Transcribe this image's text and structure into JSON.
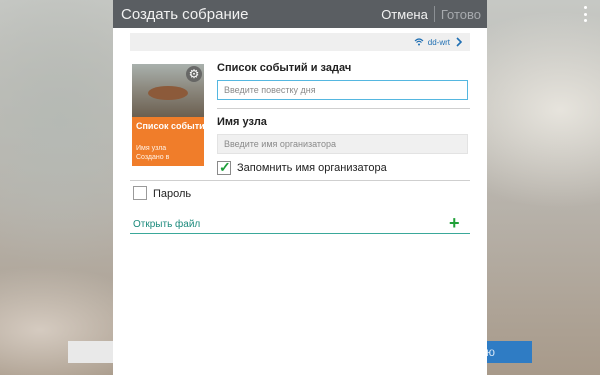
{
  "topbar": {
    "title": "Создать собрание",
    "cancel_label": "Отмена",
    "done_label": "Готово"
  },
  "network": {
    "icon": "wifi-icon",
    "ssid": "dd-wrt"
  },
  "thumbnail": {
    "title": "Список событи...",
    "line1": "Имя узла",
    "line2": "Создано в"
  },
  "agenda": {
    "label": "Список событий и задач",
    "placeholder": "Введите повестку дня",
    "value": ""
  },
  "node": {
    "label": "Имя узла",
    "placeholder": "Введите имя организатора",
    "value": ""
  },
  "remember": {
    "label": "Запомнить имя организатора",
    "checked": true
  },
  "password": {
    "label": "Пароль",
    "checked": false
  },
  "open_file": {
    "label": "Открыть файл"
  },
  "background": {
    "right_button_text": "ю"
  },
  "colors": {
    "accent_orange": "#f07d2a",
    "accent_blue": "#55b7e0",
    "accent_green": "#20a038",
    "bar": "#5a5e62"
  }
}
